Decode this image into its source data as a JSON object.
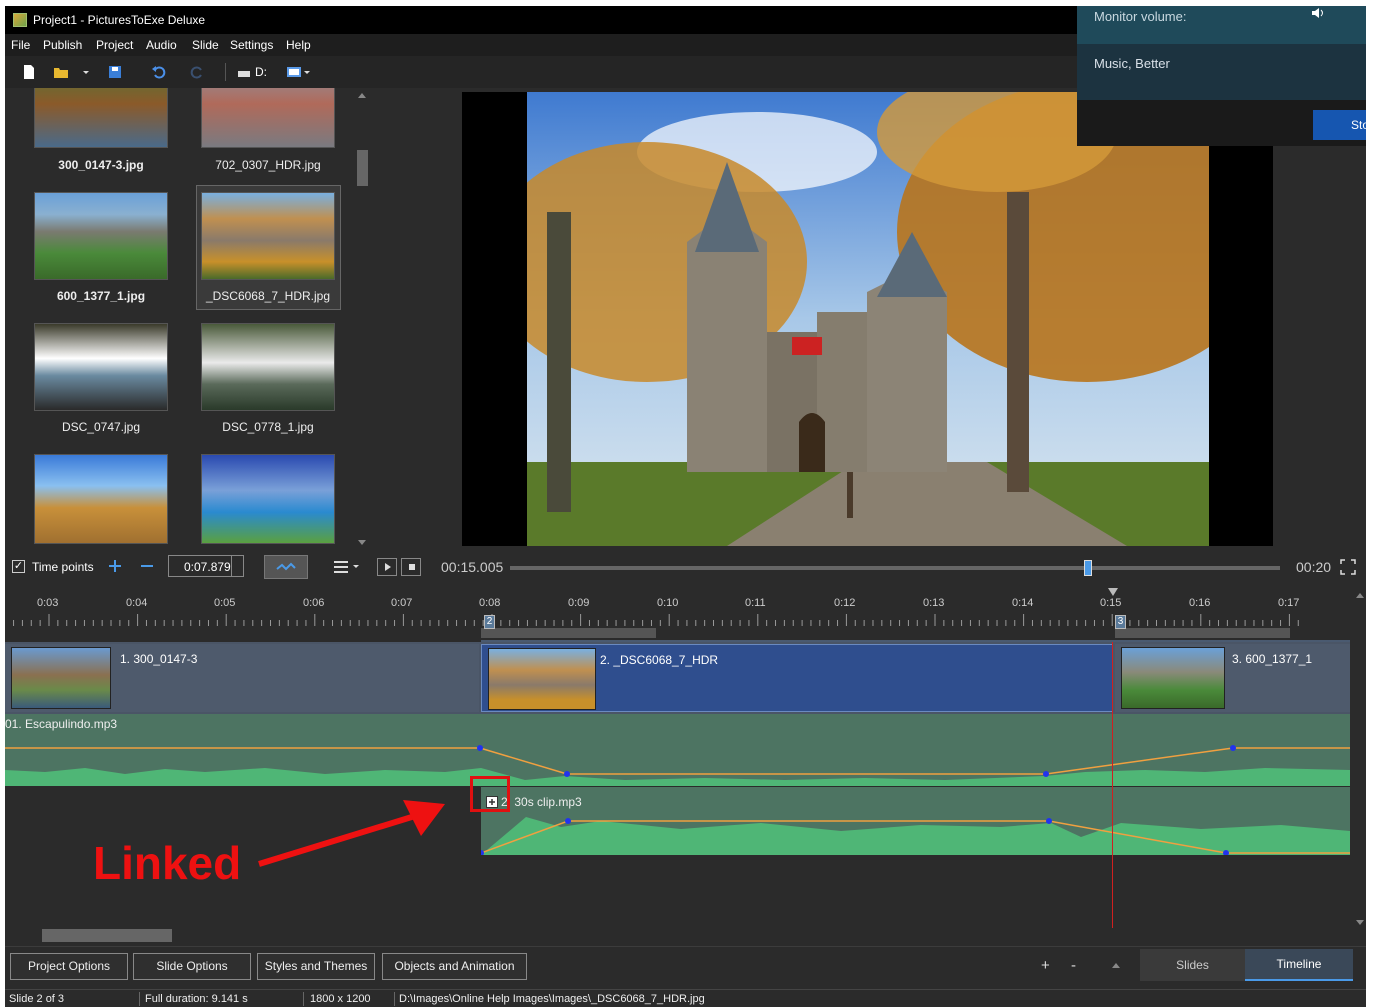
{
  "window": {
    "title": "Project1 - PicturesToExe Deluxe"
  },
  "menu": {
    "items": [
      "File",
      "Publish",
      "Project",
      "Audio",
      "Slide",
      "Settings",
      "Help"
    ]
  },
  "toolbar": {
    "drive_label": "D:"
  },
  "thumbnails": [
    {
      "label": "300_0147-3.jpg"
    },
    {
      "label": "702_0307_HDR.jpg"
    },
    {
      "label": "600_1377_1.jpg"
    },
    {
      "label": "_DSC6068_7_HDR.jpg"
    },
    {
      "label": "DSC_0747.jpg"
    },
    {
      "label": "DSC_0778_1.jpg"
    }
  ],
  "monitor": {
    "volume_label": "Monitor volume:",
    "quality_label": "Music, Better",
    "button_label": "Sto"
  },
  "timecontrols": {
    "time_points_label": "Time points",
    "time_value": "0:07.879",
    "current_time": "00:15.005",
    "end_time": "00:20",
    "playhead_fraction": 0.75
  },
  "ruler": {
    "ticks": [
      "0:03",
      "0:04",
      "0:05",
      "0:06",
      "0:07",
      "0:08",
      "0:09",
      "0:10",
      "0:11",
      "0:12",
      "0:13",
      "0:14",
      "0:15",
      "0:16",
      "0:17"
    ],
    "markers": [
      "2",
      "3"
    ]
  },
  "slides": [
    {
      "label": "1. 300_0147-3"
    },
    {
      "label": "2. _DSC6068_7_HDR"
    },
    {
      "label": "3. 600_1377_1"
    }
  ],
  "audio": [
    {
      "label": "01. Escapulindo.mp3"
    },
    {
      "label": "2. 30s clip.mp3"
    }
  ],
  "annotation": {
    "text": "Linked",
    "color": "#ee1111"
  },
  "buttons": {
    "project_options": "Project Options",
    "slide_options": "Slide Options",
    "styles_themes": "Styles and Themes",
    "objects_animation": "Objects and Animation",
    "plus": "+",
    "minus": "-",
    "tab_slides": "Slides",
    "tab_timeline": "Timeline"
  },
  "status": {
    "slide": "Slide 2 of 3",
    "duration": "Full duration: 9.141 s",
    "resolution": "1800 x 1200",
    "path": "D:\\Images\\Online Help Images\\Images\\_DSC6068_7_HDR.jpg"
  }
}
